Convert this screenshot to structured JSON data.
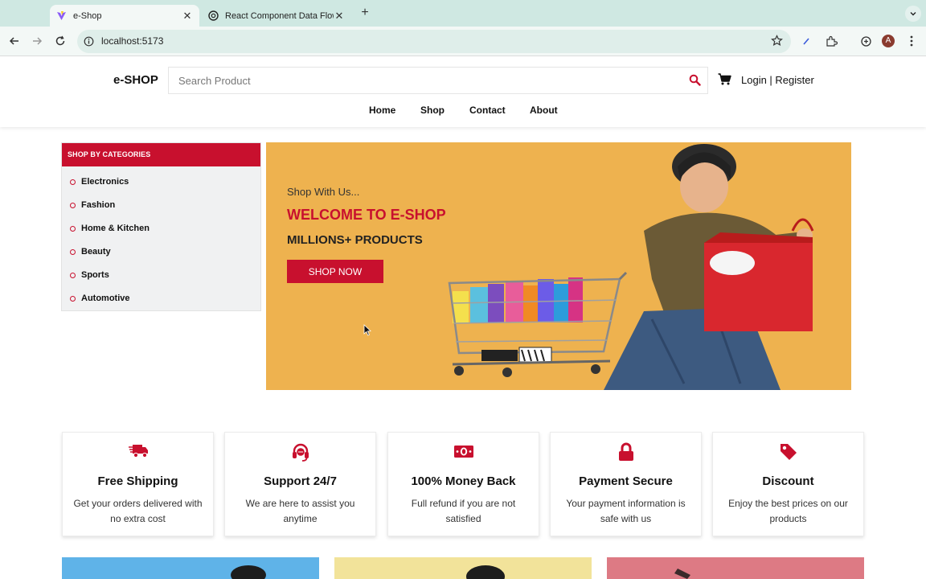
{
  "browser": {
    "tabs": [
      {
        "title": "e-Shop",
        "active": true,
        "icon": "vite-logo-icon"
      },
      {
        "title": "React Component Data Flow",
        "active": false,
        "icon": "openai-logo-icon"
      }
    ],
    "url": "localhost:5173",
    "profile_initial": "A"
  },
  "site": {
    "logo": "e-SHOP",
    "search_placeholder": "Search Product",
    "auth_label": "Login | Register",
    "nav": [
      "Home",
      "Shop",
      "Contact",
      "About"
    ],
    "accent": "#c8102e"
  },
  "categories": {
    "heading": "SHOP BY CATEGORIES",
    "items": [
      "Electronics",
      "Fashion",
      "Home & Kitchen",
      "Beauty",
      "Sports",
      "Automotive"
    ]
  },
  "hero": {
    "kicker": "Shop With Us...",
    "title": "WELCOME TO E-SHOP",
    "subtitle": "MILLIONS+ PRODUCTS",
    "button": "SHOP NOW",
    "bg_color": "#eeb24f"
  },
  "features": [
    {
      "icon": "truck-icon",
      "title": "Free Shipping",
      "desc": "Get your orders delivered with no extra cost"
    },
    {
      "icon": "headset-icon",
      "title": "Support 24/7",
      "desc": "We are here to assist you anytime"
    },
    {
      "icon": "money-icon",
      "title": "100% Money Back",
      "desc": "Full refund if you are not satisfied"
    },
    {
      "icon": "lock-icon",
      "title": "Payment Secure",
      "desc": "Your payment information is safe with us"
    },
    {
      "icon": "tag-icon",
      "title": "Discount",
      "desc": "Enjoy the best prices on our products"
    }
  ],
  "promos": [
    {
      "bg": "#5fb3e8"
    },
    {
      "bg": "#f2e39a"
    },
    {
      "bg": "#dd7a84"
    }
  ]
}
